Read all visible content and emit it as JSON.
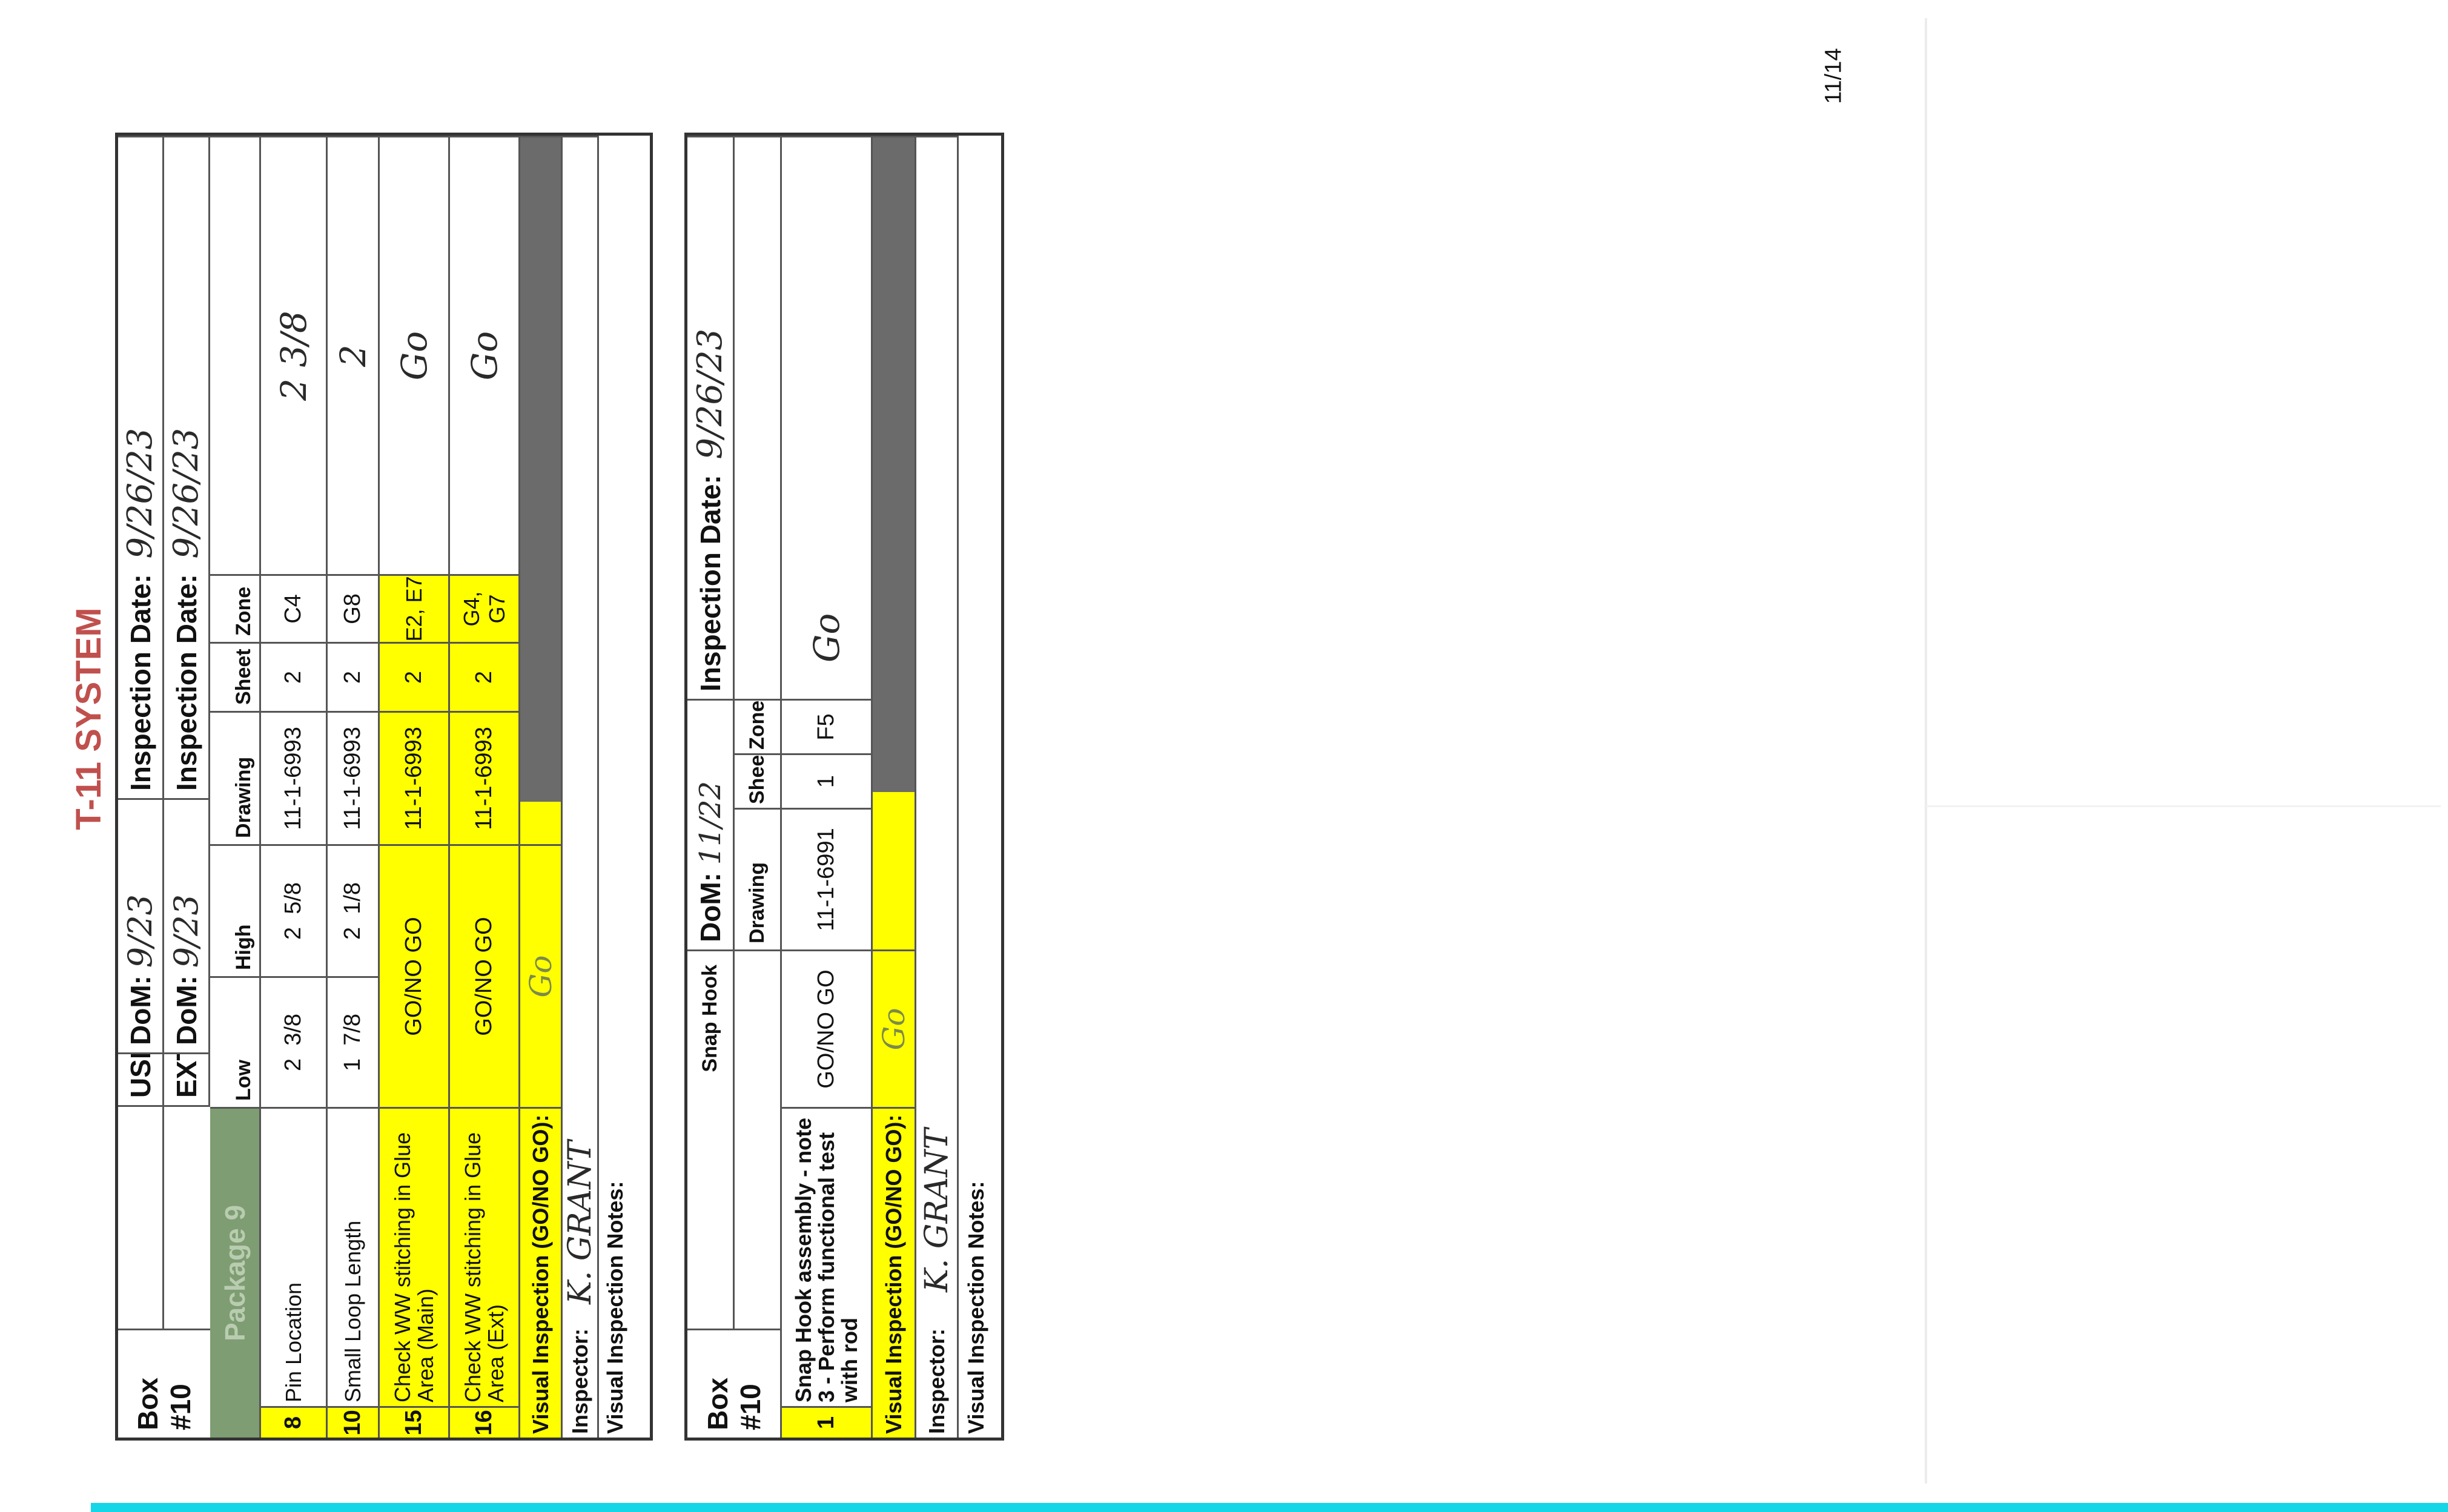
{
  "page_number": "11/14",
  "title": "T-11 SYSTEM",
  "form1": {
    "box_label": "Box #10",
    "package_label": "Package 9",
    "usl_label": "USL",
    "ext_label": "EXT",
    "dom_label_1": "DoM:",
    "dom_value_1": "9/23",
    "dom_label_2": "DoM:",
    "dom_value_2": "9/23",
    "insp_label_1": "Inspection Date:",
    "insp_value_1": "9/26/23",
    "insp_label_2": "Inspection Date:",
    "insp_value_2": "9/26/23",
    "columns": {
      "low": "Low",
      "high": "High",
      "drawing": "Drawing",
      "sheet": "Sheet",
      "zone": "Zone"
    },
    "rows": [
      {
        "num": "8",
        "desc": "Pin Location",
        "low": "2  3/8",
        "high": "2  5/8",
        "drawing": "11-1-6993",
        "sheet": "2",
        "zone": "C4",
        "result": "2 3/8"
      },
      {
        "num": "10",
        "desc": "Small Loop Length",
        "low": "1  7/8",
        "high": "2  1/8",
        "drawing": "11-1-6993",
        "sheet": "2",
        "zone": "G8",
        "result": "2"
      },
      {
        "num": "15",
        "desc": "Check WW stitching in Glue Area (Main)",
        "spec": "GO/NO GO",
        "drawing": "11-1-6993",
        "sheet": "2",
        "zone": "E2, E7",
        "result": "Go"
      },
      {
        "num": "16",
        "desc": "Check WW stitching in Glue Area (Ext)",
        "spec": "GO/NO GO",
        "drawing": "11-1-6993",
        "sheet": "2",
        "zone": "G4, G7",
        "result": "Go"
      }
    ],
    "visual_label": "Visual Inspection (GO/NO GO):",
    "visual_value": "Go",
    "inspector_label": "Inspector:",
    "inspector_value": "K. GRANT",
    "notes_label": "Visual Inspection Notes:"
  },
  "form2": {
    "box_label": "Box #10",
    "component_label": "Snap Hook",
    "dom_label": "DoM:",
    "dom_value": "11/22",
    "insp_label": "Inspection Date:",
    "insp_value": "9/26/23",
    "columns": {
      "drawing": "Drawing",
      "sheet": "Sheet",
      "zone": "Zone"
    },
    "row": {
      "num": "1",
      "desc": "Snap Hook assembly - note 3 - Perform functional test with rod",
      "spec": "GO/NO GO",
      "drawing": "11-1-6991",
      "sheet": "1",
      "zone": "F5",
      "result": "Go"
    },
    "visual_label": "Visual Inspection (GO/NO GO):",
    "visual_value": "Go",
    "inspector_label": "Inspector:",
    "inspector_value": "K. GRANT",
    "notes_label": "Visual Inspection Notes:"
  },
  "colors": {
    "highlight": "#ffff00",
    "title": "#c0504d",
    "package_band": "#7e9d72",
    "stripe": "#14d6e6"
  }
}
